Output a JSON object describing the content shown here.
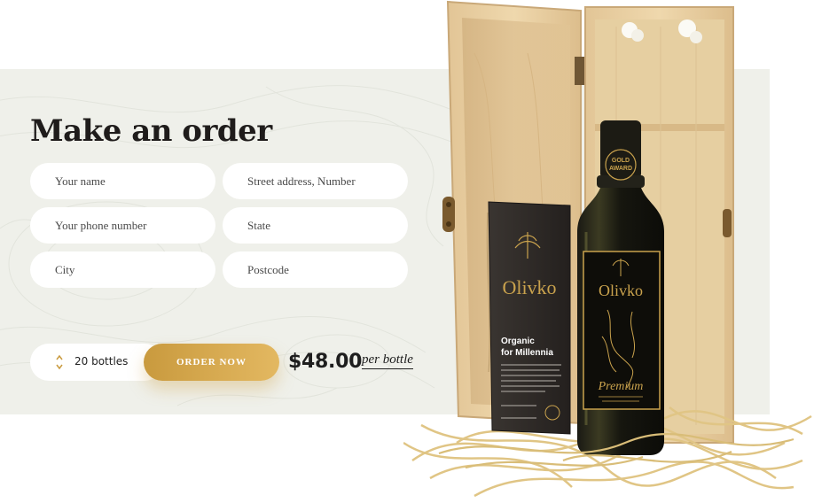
{
  "form": {
    "title": "Make an order",
    "fields": {
      "name": "Your name",
      "street": "Street address, Number",
      "phone": "Your phone number",
      "state": "State",
      "city": "City",
      "postcode": "Postcode"
    }
  },
  "order": {
    "quantity_label": "20 bottles",
    "button_label": "ORDER NOW",
    "price": "$48.00",
    "price_unit": "per bottle"
  },
  "product": {
    "brand": "Olivko",
    "card_heading_line1": "Organic",
    "card_heading_line2": "for Millennia",
    "label_line": "Premium",
    "badge_line1": "GOLD",
    "badge_line2": "AWARD"
  },
  "colors": {
    "accent": "#d4a74e",
    "panel": "#eff0ea",
    "title": "#1f1c1b"
  }
}
